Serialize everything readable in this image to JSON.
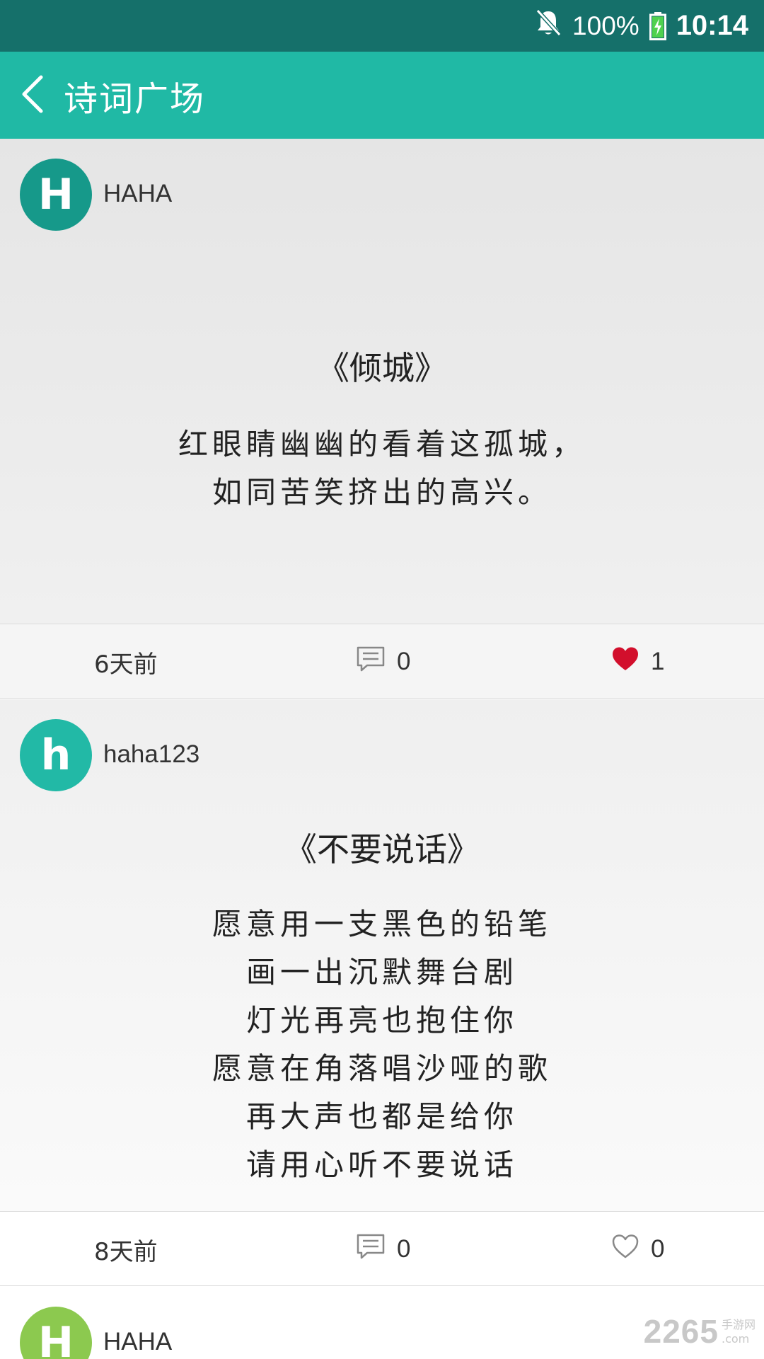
{
  "status_bar": {
    "battery": "100%",
    "time": "10:14",
    "icons": [
      "bell-muted-icon",
      "battery-charging-icon"
    ]
  },
  "app_bar": {
    "title": "诗词广场",
    "back_icon": "chevron-left-icon"
  },
  "colors": {
    "status_bar": "#15706a",
    "app_bar": "#20b9a5",
    "avatar_dark": "#16998a",
    "avatar_teal": "#22b9a6",
    "avatar_green": "#8cc94f",
    "heart_red": "#d20f2c"
  },
  "posts": [
    {
      "avatar_letter": "H",
      "username": "HAHA",
      "poem_title": "《倾城》",
      "poem_lines": [
        "红眼睛幽幽的看着这孤城，",
        "如同苦笑挤出的高兴。"
      ],
      "time": "6天前",
      "comments": "0",
      "likes": "1",
      "liked": true
    },
    {
      "avatar_letter": "h",
      "username": "haha123",
      "poem_title": "《不要说话》",
      "poem_lines": [
        "愿意用一支黑色的铅笔",
        "画一出沉默舞台剧",
        "灯光再亮也抱住你",
        "愿意在角落唱沙哑的歌",
        "再大声也都是给你",
        "请用心听不要说话"
      ],
      "time": "8天前",
      "comments": "0",
      "likes": "0",
      "liked": false
    },
    {
      "avatar_letter": "H",
      "username": "HAHA"
    }
  ],
  "watermark": {
    "main": "2265",
    "sub1": "手游网",
    "sub2": ".com"
  }
}
